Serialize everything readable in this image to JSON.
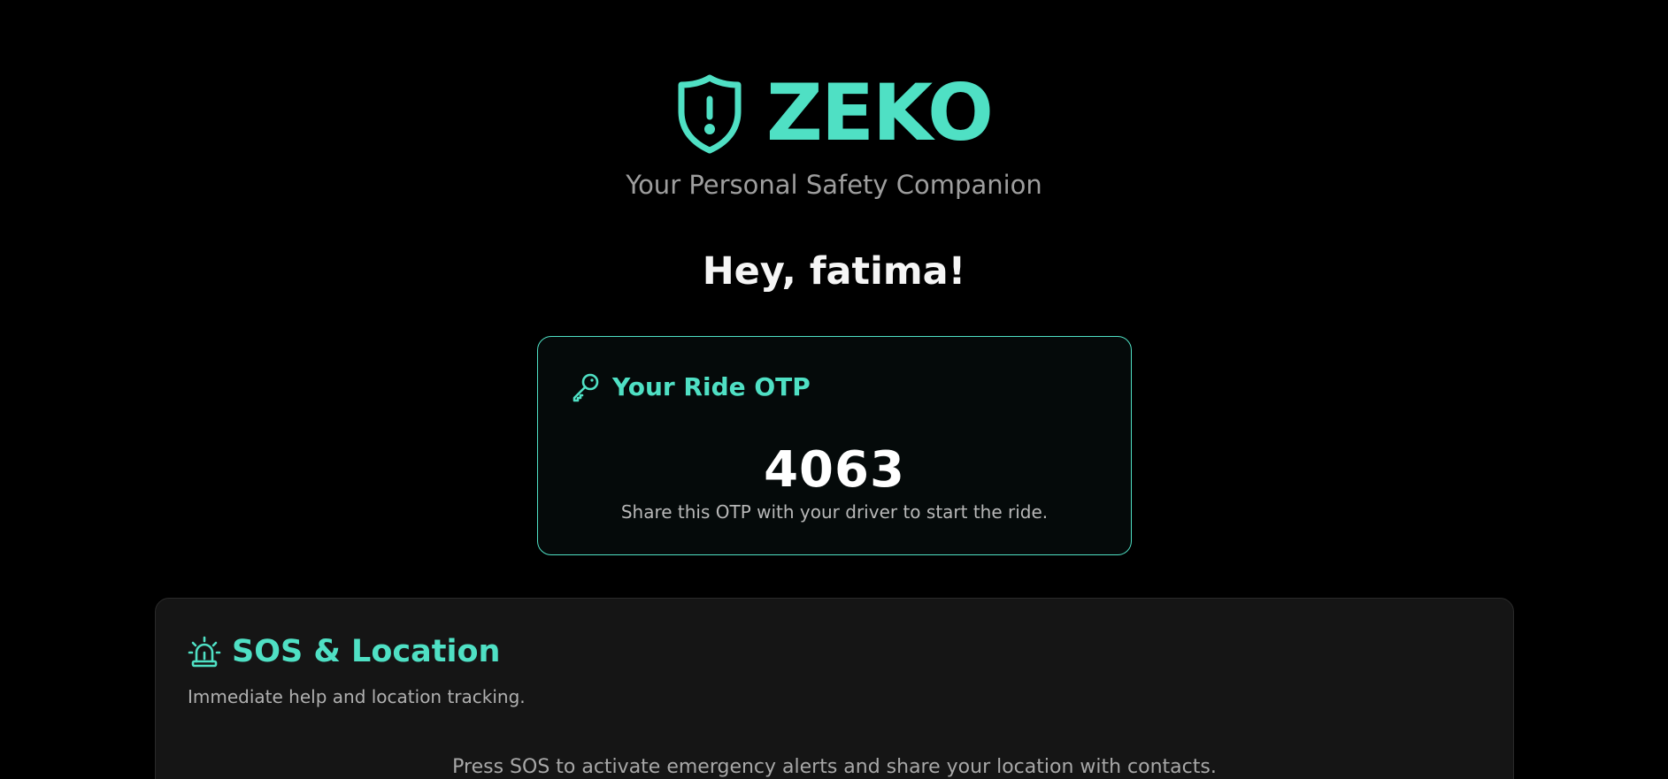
{
  "brand": {
    "name": "ZEKO",
    "tagline": "Your Personal Safety Companion",
    "icon": "shield-alert-icon",
    "accent_color": "#4fe0c4"
  },
  "greeting": "Hey, fatima!",
  "otp_card": {
    "icon": "key-icon",
    "title": "Your Ride OTP",
    "code": "4063",
    "hint": "Share this OTP with your driver to start the ride."
  },
  "sos_card": {
    "icon": "siren-icon",
    "title": "SOS & Location",
    "subtitle": "Immediate help and location tracking.",
    "instructions": "Press SOS to activate emergency alerts and share your location with contacts."
  }
}
